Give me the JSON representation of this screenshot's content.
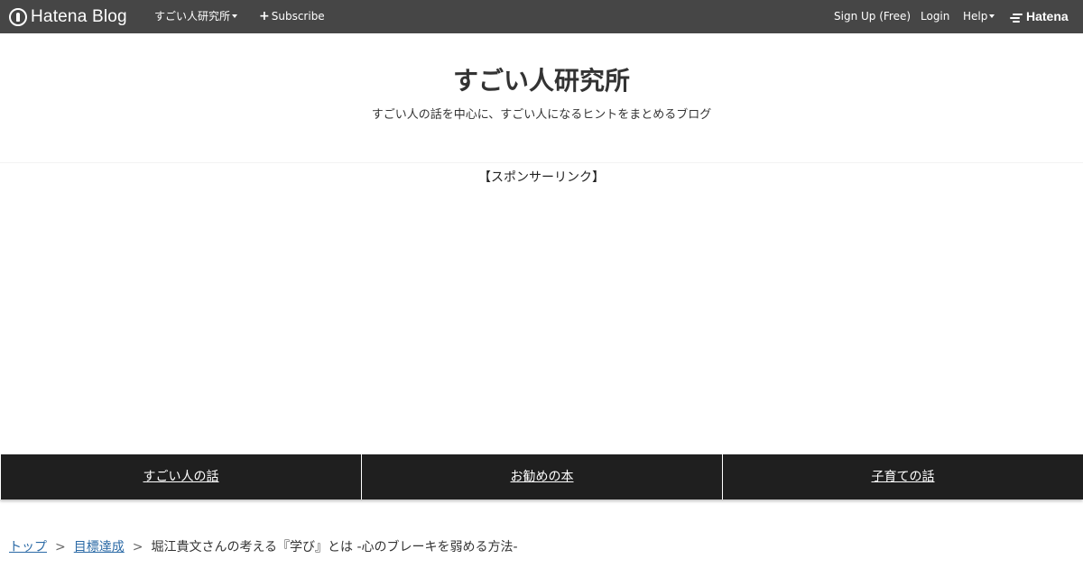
{
  "globalbar": {
    "logo_text": "Hatena Blog",
    "blog_menu_label": "すごい人研究所",
    "subscribe_label": "Subscribe",
    "signup_label": "Sign Up (Free)",
    "login_label": "Login",
    "help_label": "Help",
    "brand_label": "Hatena",
    "background_color": "#464646"
  },
  "header": {
    "title": "すごい人研究所",
    "description": "すごい人の話を中心に、すごい人になるヒントをまとめるブログ"
  },
  "sponsor_label": "【スポンサーリンク】",
  "category_nav": {
    "items": [
      {
        "label": "すごい人の話"
      },
      {
        "label": "お勧めの本"
      },
      {
        "label": "子育ての話"
      }
    ],
    "background_color": "#1f1f1f"
  },
  "breadcrumb": {
    "items": [
      {
        "label": "トップ"
      },
      {
        "label": "目標達成"
      }
    ],
    "separator": ">",
    "current": "堀江貴文さんの考える『学び』とは -心のブレーキを弱める方法-"
  },
  "icons": {
    "logo": "hatena-blog-logo-icon",
    "subscribe": "plus-icon",
    "dropdown": "caret-down-icon",
    "brand": "hatena-logo-icon"
  },
  "link_color": "#2b6aa6"
}
